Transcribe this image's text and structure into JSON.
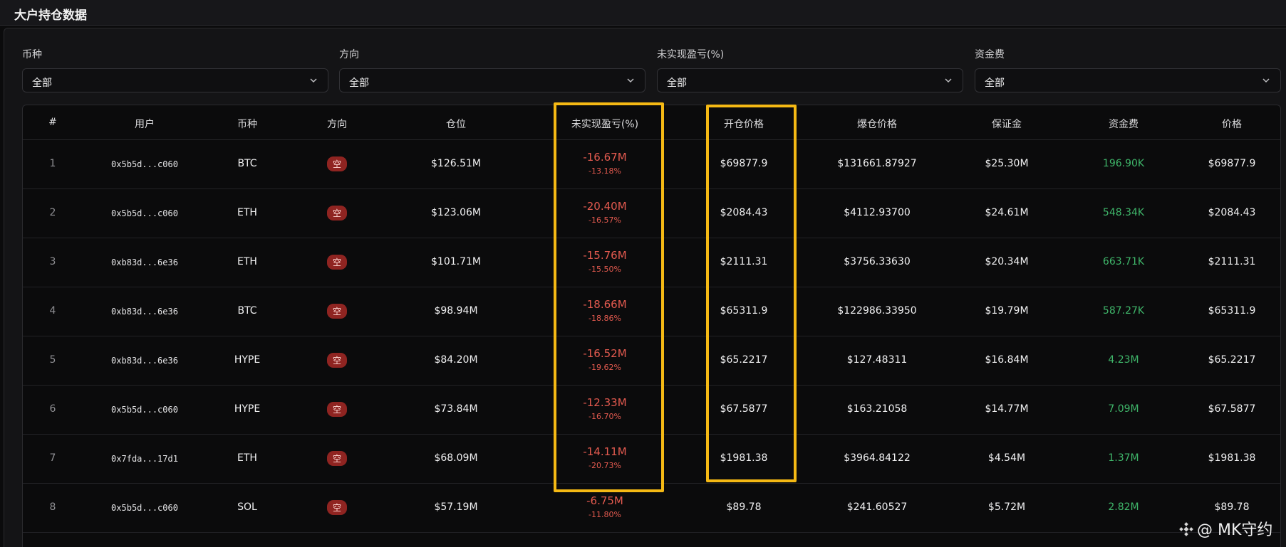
{
  "header": {
    "title": "大户持仓数据"
  },
  "filters": [
    {
      "label": "币种",
      "value": "全部"
    },
    {
      "label": "方向",
      "value": "全部"
    },
    {
      "label": "未实现盈亏(%)",
      "value": "全部"
    },
    {
      "label": "资金费",
      "value": "全部"
    }
  ],
  "table": {
    "columns": [
      "#",
      "用户",
      "币种",
      "方向",
      "仓位",
      "未实现盈亏(%)",
      "开仓价格",
      "爆仓价格",
      "保证金",
      "资金费",
      "价格"
    ],
    "rows": [
      {
        "idx": "1",
        "user": "0x5b5d...c060",
        "coin": "BTC",
        "dir": "空",
        "size": "$126.51M",
        "pnl": "-16.67M",
        "pnl_pct": "-13.18%",
        "entry": "$69877.9",
        "liq": "$131661.87927",
        "margin": "$25.30M",
        "funding": "196.90K",
        "price": "$69877.9"
      },
      {
        "idx": "2",
        "user": "0x5b5d...c060",
        "coin": "ETH",
        "dir": "空",
        "size": "$123.06M",
        "pnl": "-20.40M",
        "pnl_pct": "-16.57%",
        "entry": "$2084.43",
        "liq": "$4112.93700",
        "margin": "$24.61M",
        "funding": "548.34K",
        "price": "$2084.43"
      },
      {
        "idx": "3",
        "user": "0xb83d...6e36",
        "coin": "ETH",
        "dir": "空",
        "size": "$101.71M",
        "pnl": "-15.76M",
        "pnl_pct": "-15.50%",
        "entry": "$2111.31",
        "liq": "$3756.33630",
        "margin": "$20.34M",
        "funding": "663.71K",
        "price": "$2111.31"
      },
      {
        "idx": "4",
        "user": "0xb83d...6e36",
        "coin": "BTC",
        "dir": "空",
        "size": "$98.94M",
        "pnl": "-18.66M",
        "pnl_pct": "-18.86%",
        "entry": "$65311.9",
        "liq": "$122986.33950",
        "margin": "$19.79M",
        "funding": "587.27K",
        "price": "$65311.9"
      },
      {
        "idx": "5",
        "user": "0xb83d...6e36",
        "coin": "HYPE",
        "dir": "空",
        "size": "$84.20M",
        "pnl": "-16.52M",
        "pnl_pct": "-19.62%",
        "entry": "$65.2217",
        "liq": "$127.48311",
        "margin": "$16.84M",
        "funding": "4.23M",
        "price": "$65.2217"
      },
      {
        "idx": "6",
        "user": "0x5b5d...c060",
        "coin": "HYPE",
        "dir": "空",
        "size": "$73.84M",
        "pnl": "-12.33M",
        "pnl_pct": "-16.70%",
        "entry": "$67.5877",
        "liq": "$163.21058",
        "margin": "$14.77M",
        "funding": "7.09M",
        "price": "$67.5877"
      },
      {
        "idx": "7",
        "user": "0x7fda...17d1",
        "coin": "ETH",
        "dir": "空",
        "size": "$68.09M",
        "pnl": "-14.11M",
        "pnl_pct": "-20.73%",
        "entry": "$1981.38",
        "liq": "$3964.84122",
        "margin": "$4.54M",
        "funding": "1.37M",
        "price": "$1981.38"
      },
      {
        "idx": "8",
        "user": "0x5b5d...c060",
        "coin": "SOL",
        "dir": "空",
        "size": "$57.19M",
        "pnl": "-6.75M",
        "pnl_pct": "-11.80%",
        "entry": "$89.78",
        "liq": "$241.60527",
        "margin": "$5.72M",
        "funding": "2.82M",
        "price": "$89.78"
      }
    ]
  },
  "watermark": {
    "text": "@ MK守约"
  },
  "colors": {
    "negative": "#e35a4f",
    "positive": "#3fb66a",
    "short_badge": "#8f2421",
    "highlight": "#f5b914"
  },
  "icons": {
    "filter_chevron": "chevron-down-icon",
    "watermark_logo": "binance-square-icon"
  }
}
